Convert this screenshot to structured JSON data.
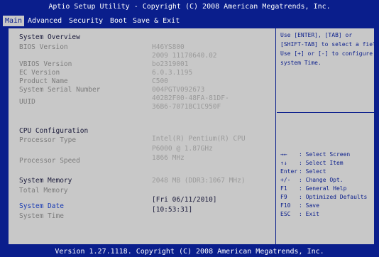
{
  "title": "Aptio Setup Utility - Copyright (C) 2008 American Megatrends, Inc.",
  "footer": "Version 1.27.1118. Copyright (C) 2008 American Megatrends, Inc.",
  "tabs": [
    "Main",
    "Advanced",
    "Security",
    "Boot",
    "Save & Exit"
  ],
  "main": {
    "system_overview": "System Overview",
    "bios_version_label": "BIOS Version",
    "bios_version": "H46YS800",
    "bios_date": "2009 11170640.02",
    "vbios_version_label": "VBIOS Version",
    "vbios_version": "bo2319001",
    "ec_version_label": "EC Version",
    "ec_version": "6.0.3.1195",
    "product_name_label": "Product Name",
    "product_name": "C500",
    "serial_label": "System Serial Number",
    "serial": "004PGTV092673",
    "uuid_label": "UUID",
    "uuid_1": "402B2F00-48FA-81DF-",
    "uuid_2": "36B6-7071BC1C950F",
    "cpu_config": "CPU Configuration",
    "processor_type_label": "Processor Type",
    "processor_type_1": "Intel(R) Pentium(R) CPU",
    "processor_type_2": "P6000 @ 1.87GHz",
    "processor_speed_label": "Processor Speed",
    "processor_speed": "1866 MHz",
    "system_memory": "System Memory",
    "total_memory_label": "Total Memory",
    "total_memory": "2048 MB (DDR3:1067 MHz)",
    "system_date_label": "System Date",
    "system_date": "[Fri 06/11/2010]",
    "system_time_label": "System Time",
    "system_time": "[10:53:31]"
  },
  "help": {
    "line1": "Use [ENTER], [TAB] or",
    "line2": " [SHIFT-TAB] to select a field",
    "line3": "Use [+] or [-] to configure",
    "line4": "system Time."
  },
  "keys": [
    {
      "key": "→←",
      "desc": ": Select Screen"
    },
    {
      "key": "↑↓",
      "desc": ": Select Item"
    },
    {
      "key": "Enter",
      "desc": ": Select"
    },
    {
      "key": "+/-",
      "desc": ": Change Opt."
    },
    {
      "key": "F1",
      "desc": ": General Help"
    },
    {
      "key": "F9",
      "desc": ": Optimized Defaults"
    },
    {
      "key": "F10",
      "desc": ": Save"
    },
    {
      "key": "ESC",
      "desc": ": Exit"
    }
  ]
}
